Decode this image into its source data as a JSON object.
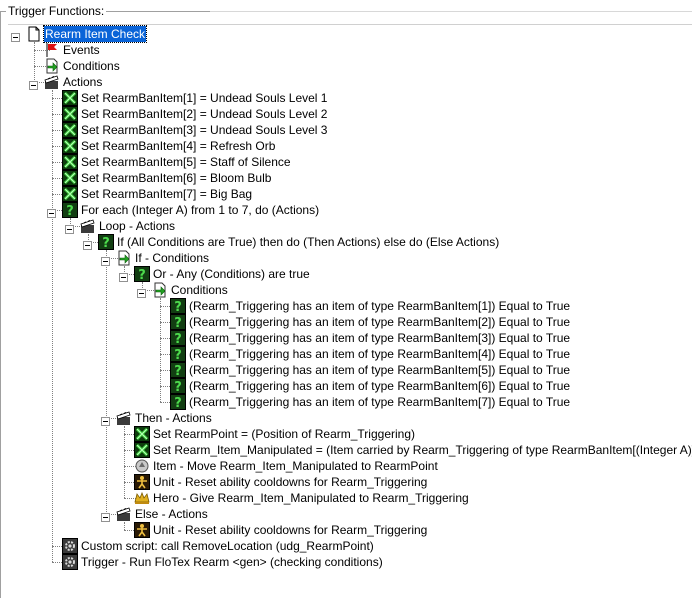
{
  "panel": {
    "title": "Trigger Functions:"
  },
  "tree": [
    {
      "id": "root",
      "level": 0,
      "icon": "trigger",
      "label": "Rearm Item Check",
      "toggle": "minus",
      "selected": true,
      "parent": null
    },
    {
      "id": "events",
      "level": 1,
      "icon": "events",
      "label": "Events",
      "toggle": null,
      "parent": "root"
    },
    {
      "id": "conditions",
      "level": 1,
      "icon": "conditions",
      "label": "Conditions",
      "toggle": null,
      "parent": "root"
    },
    {
      "id": "actions",
      "level": 1,
      "icon": "actions",
      "label": "Actions",
      "toggle": "minus",
      "parent": "root"
    },
    {
      "id": "a1",
      "level": 2,
      "icon": "set",
      "label": "Set RearmBanItem[1] = Undead Souls Level 1",
      "toggle": null,
      "parent": "actions"
    },
    {
      "id": "a2",
      "level": 2,
      "icon": "set",
      "label": "Set RearmBanItem[2] = Undead Souls Level 2",
      "toggle": null,
      "parent": "actions"
    },
    {
      "id": "a3",
      "level": 2,
      "icon": "set",
      "label": "Set RearmBanItem[3] = Undead Souls Level 3",
      "toggle": null,
      "parent": "actions"
    },
    {
      "id": "a4",
      "level": 2,
      "icon": "set",
      "label": "Set RearmBanItem[4] = Refresh Orb",
      "toggle": null,
      "parent": "actions"
    },
    {
      "id": "a5",
      "level": 2,
      "icon": "set",
      "label": "Set RearmBanItem[5] = Staff of Silence",
      "toggle": null,
      "parent": "actions"
    },
    {
      "id": "a6",
      "level": 2,
      "icon": "set",
      "label": "Set RearmBanItem[6] = Bloom Bulb",
      "toggle": null,
      "parent": "actions"
    },
    {
      "id": "a7",
      "level": 2,
      "icon": "set",
      "label": "Set RearmBanItem[7] = Big Bag",
      "toggle": null,
      "parent": "actions"
    },
    {
      "id": "foreach",
      "level": 2,
      "icon": "question",
      "label": "For each (Integer A) from 1 to 7, do (Actions)",
      "toggle": "minus",
      "parent": "actions"
    },
    {
      "id": "loop",
      "level": 3,
      "icon": "actions",
      "label": "Loop - Actions",
      "toggle": "minus",
      "parent": "foreach"
    },
    {
      "id": "if",
      "level": 4,
      "icon": "question",
      "label": "If (All Conditions are True) then do (Then Actions) else do (Else Actions)",
      "toggle": "minus",
      "parent": "loop"
    },
    {
      "id": "ifcond",
      "level": 5,
      "icon": "conditions",
      "label": "If - Conditions",
      "toggle": "minus",
      "parent": "if"
    },
    {
      "id": "or",
      "level": 6,
      "icon": "question",
      "label": "Or - Any (Conditions) are true",
      "toggle": "minus",
      "parent": "ifcond"
    },
    {
      "id": "orcond",
      "level": 7,
      "icon": "conditions",
      "label": "Conditions",
      "toggle": "minus",
      "parent": "or"
    },
    {
      "id": "c1",
      "level": 8,
      "icon": "question",
      "label": "(Rearm_Triggering has an item of type RearmBanItem[1]) Equal to True",
      "toggle": null,
      "parent": "orcond"
    },
    {
      "id": "c2",
      "level": 8,
      "icon": "question",
      "label": "(Rearm_Triggering has an item of type RearmBanItem[2]) Equal to True",
      "toggle": null,
      "parent": "orcond"
    },
    {
      "id": "c3",
      "level": 8,
      "icon": "question",
      "label": "(Rearm_Triggering has an item of type RearmBanItem[3]) Equal to True",
      "toggle": null,
      "parent": "orcond"
    },
    {
      "id": "c4",
      "level": 8,
      "icon": "question",
      "label": "(Rearm_Triggering has an item of type RearmBanItem[4]) Equal to True",
      "toggle": null,
      "parent": "orcond"
    },
    {
      "id": "c5",
      "level": 8,
      "icon": "question",
      "label": "(Rearm_Triggering has an item of type RearmBanItem[5]) Equal to True",
      "toggle": null,
      "parent": "orcond"
    },
    {
      "id": "c6",
      "level": 8,
      "icon": "question",
      "label": "(Rearm_Triggering has an item of type RearmBanItem[6]) Equal to True",
      "toggle": null,
      "parent": "orcond"
    },
    {
      "id": "c7",
      "level": 8,
      "icon": "question",
      "label": "(Rearm_Triggering has an item of type RearmBanItem[7]) Equal to True",
      "toggle": null,
      "parent": "orcond"
    },
    {
      "id": "then",
      "level": 5,
      "icon": "actions",
      "label": "Then - Actions",
      "toggle": "minus",
      "parent": "if"
    },
    {
      "id": "t1",
      "level": 6,
      "icon": "set",
      "label": "Set RearmPoint = (Position of Rearm_Triggering)",
      "toggle": null,
      "parent": "then"
    },
    {
      "id": "t2",
      "level": 6,
      "icon": "set",
      "label": "Set Rearm_Item_Manipulated = (Item carried by Rearm_Triggering of type RearmBanItem[(Integer A)])",
      "toggle": null,
      "parent": "then"
    },
    {
      "id": "t3",
      "level": 6,
      "icon": "item",
      "label": "Item - Move Rearm_Item_Manipulated to RearmPoint",
      "toggle": null,
      "parent": "then"
    },
    {
      "id": "t4",
      "level": 6,
      "icon": "unit",
      "label": "Unit - Reset ability cooldowns for Rearm_Triggering",
      "toggle": null,
      "parent": "then"
    },
    {
      "id": "t5",
      "level": 6,
      "icon": "hero",
      "label": "Hero - Give Rearm_Item_Manipulated to Rearm_Triggering",
      "toggle": null,
      "parent": "then"
    },
    {
      "id": "else",
      "level": 5,
      "icon": "actions",
      "label": "Else - Actions",
      "toggle": "minus",
      "parent": "if"
    },
    {
      "id": "e1",
      "level": 6,
      "icon": "unit",
      "label": "Unit - Reset ability cooldowns for Rearm_Triggering",
      "toggle": null,
      "parent": "else"
    },
    {
      "id": "custom",
      "level": 2,
      "icon": "gear",
      "label": "Custom script:   call RemoveLocation (udg_RearmPoint)",
      "toggle": null,
      "parent": "actions"
    },
    {
      "id": "run",
      "level": 2,
      "icon": "gear",
      "label": "Trigger - Run FloTex Rearm <gen> (checking conditions)",
      "toggle": null,
      "parent": "actions"
    }
  ],
  "colors": {
    "selection": "#0a64d8",
    "set_icon": "#1e8f1e",
    "question_icon": "#2a9a2a",
    "events_flag": "#e01010"
  }
}
